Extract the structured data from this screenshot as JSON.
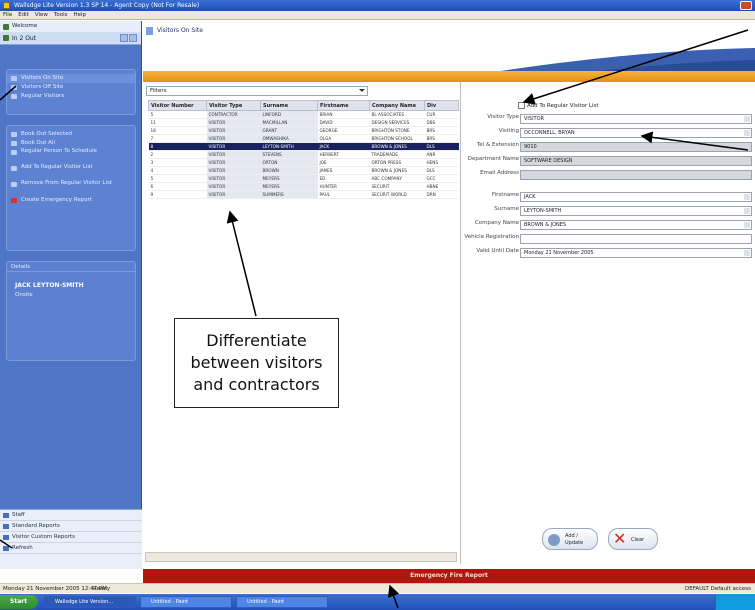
{
  "window": {
    "title": "Wallsdge Lite Version 1.3 SP 14 - Agent Copy (Not For Resale)"
  },
  "menu": [
    "File",
    "Edit",
    "View",
    "Tools",
    "Help"
  ],
  "sidebar": {
    "top_item": "Welcome",
    "nav_item": "In 2 Out",
    "panel1": [
      "Visitors On Site",
      "Visitors Off Site",
      "Regular Visitors"
    ],
    "panel2": [
      "Book Out Selected",
      "Book Out All",
      "Regular Person To Schedule",
      "Add To Regular Visitor List",
      "Remove From Regular Visitor List",
      "Create Emergency Report"
    ],
    "details_header": "Details",
    "details_name": "JACK LEYTON-SMITH",
    "details_status": "Onsite",
    "bottom": [
      "Staff",
      "Standard Reports",
      "Visitor Custom Reports",
      "Refresh"
    ]
  },
  "header": {
    "title": "Visitors On Site"
  },
  "grid": {
    "filter_value": "Filters",
    "columns": [
      "Visitor Number",
      "Visitor Type",
      "Surname",
      "Firstname",
      "Company Name",
      "Div"
    ],
    "rows": [
      [
        "5",
        "CONTRACTOR",
        "LINFORD",
        "BRIAN",
        "BL ASSOCIATES",
        "CUR"
      ],
      [
        "11",
        "VISITOR",
        "MACMILLAN",
        "DAVID",
        "DESIGN SERVICES",
        "DBS"
      ],
      [
        "18",
        "VISITOR",
        "GRANT",
        "GEORGE",
        "BRIGHTON STONE",
        "BRS"
      ],
      [
        "7",
        "VISITOR",
        "OMWASHIKA",
        "OLGA",
        "BRIGHTON SCHOOL",
        "BRS"
      ],
      [
        "8",
        "VISITOR",
        "LEYTON-SMITH",
        "JACK",
        "BROWN & JONES",
        "DLS"
      ],
      [
        "2",
        "VISITOR",
        "STEVENS",
        "HERBERT",
        "TRADEMADE",
        "ANR"
      ],
      [
        "3",
        "VISITOR",
        "ORTON",
        "JOE",
        "ORTON PRESS",
        "HENS"
      ],
      [
        "4",
        "VISITOR",
        "BROWN",
        "JAMES",
        "BROWN & JONES",
        "DLS"
      ],
      [
        "5",
        "VISITOR",
        "MEYERS",
        "ED",
        "ABC COMPANY",
        "GCC"
      ],
      [
        "6",
        "VISITOR",
        "MEYERS",
        "HUNTER",
        "SECURIT",
        "HBNE"
      ],
      [
        "9",
        "VISITOR",
        "SUMMERS",
        "PAUL",
        "SECURIT WORLD",
        "DRN"
      ]
    ],
    "selected_row": 4
  },
  "form": {
    "checkbox_label": "Add To Regular Visitor List",
    "fields": [
      {
        "label": "Visitor Type",
        "value": "VISITOR",
        "gray": false,
        "arrow": true
      },
      {
        "label": "Visiting",
        "value": "OCCONNELL, BRYAN",
        "gray": false,
        "arrow": true
      },
      {
        "label": "Tel & Extension",
        "value": "9010",
        "gray": true,
        "arrow": false
      },
      {
        "label": "Department Name",
        "value": "SOFTWARE DESIGN",
        "gray": true,
        "arrow": false
      },
      {
        "label": "Email Address",
        "value": "",
        "gray": true,
        "arrow": false
      },
      {
        "label": "Firstname",
        "value": "JACK",
        "gray": false,
        "arrow": true
      },
      {
        "label": "Surname",
        "value": "LEYTON-SMITH",
        "gray": false,
        "arrow": true
      },
      {
        "label": "Company Name",
        "value": "BROWN & JONES",
        "gray": false,
        "arrow": true
      },
      {
        "label": "Vehicle Registration",
        "value": "",
        "gray": false,
        "arrow": false
      },
      {
        "label": "Valid Until Date",
        "value": "Monday 21 November 2005",
        "gray": false,
        "arrow": true
      }
    ],
    "add_button": "Add / Update",
    "clear_button": "Clear"
  },
  "emergency": {
    "label": "Emergency Fire Report"
  },
  "status": {
    "left": "Monday 21 November 2005  12:47 PM",
    "middle": "Ready",
    "right": "DEFAULT Default access"
  },
  "taskbar": {
    "start": "Start",
    "tasks": [
      "Wallsdge Lite Version...",
      "Untitled - Paint",
      "Untitled - Paint"
    ]
  },
  "callout": {
    "text": "Differentiate between visitors and contractors"
  }
}
